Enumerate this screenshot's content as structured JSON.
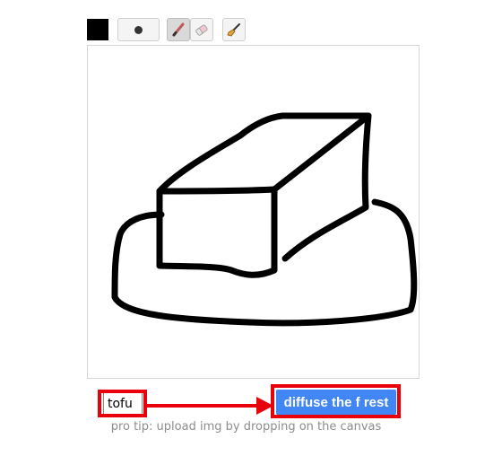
{
  "toolbar": {
    "color": "#000000",
    "brush_size_icon": "dot-icon",
    "tools": [
      {
        "name": "pencil",
        "icon": "pencil-icon",
        "active": true
      },
      {
        "name": "eraser",
        "icon": "eraser-icon",
        "active": false
      },
      {
        "name": "broom",
        "icon": "broom-icon",
        "active": false
      }
    ]
  },
  "prompt": {
    "value": "tofu"
  },
  "submit": {
    "label": "diffuse the f rest"
  },
  "tip": {
    "text": "pro tip: upload img by dropping on the canvas"
  },
  "colors": {
    "accent": "#4285f4",
    "highlight": "#e8000b",
    "tip_text": "#8d8d8d"
  }
}
